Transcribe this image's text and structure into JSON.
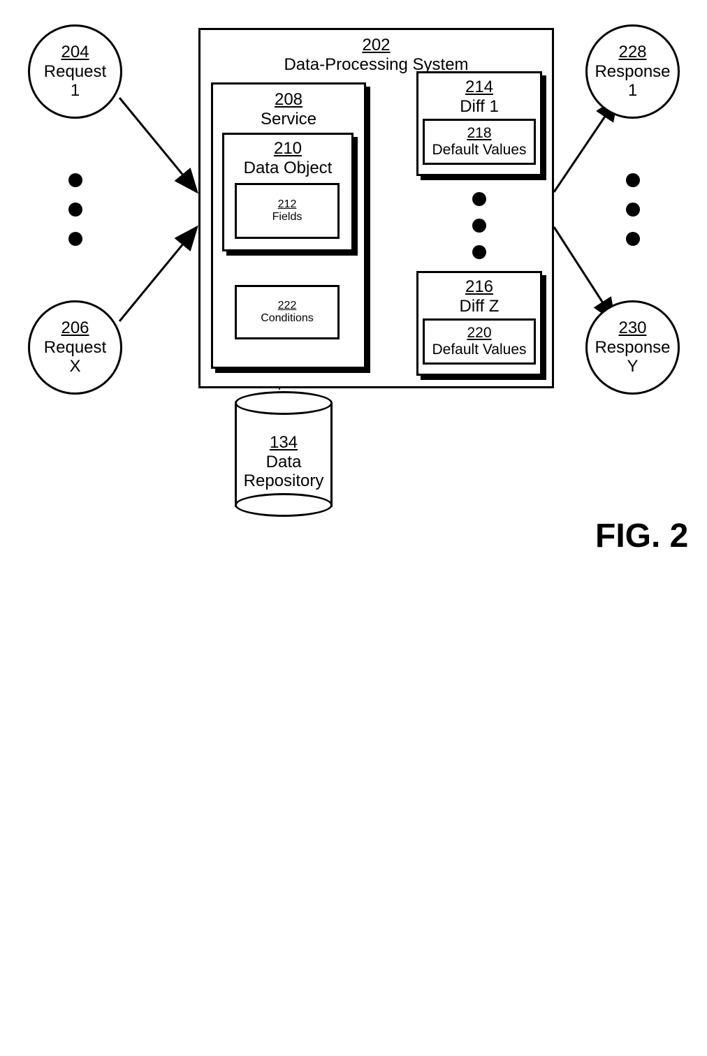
{
  "figure_label": "FIG. 2",
  "system": {
    "num": "202",
    "label": "Data-Processing System"
  },
  "request1": {
    "num": "204",
    "label_line1": "Request",
    "label_line2": "1"
  },
  "requestX": {
    "num": "206",
    "label_line1": "Request",
    "label_line2": "X"
  },
  "service": {
    "num": "208",
    "label": "Service"
  },
  "dataObject": {
    "num": "210",
    "label": "Data Object"
  },
  "fields": {
    "num": "212",
    "label": "Fields"
  },
  "diff1": {
    "num": "214",
    "label": "Diff 1"
  },
  "diffZ": {
    "num": "216",
    "label": "Diff Z"
  },
  "defaults1": {
    "num": "218",
    "label": "Default Values"
  },
  "defaultsZ": {
    "num": "220",
    "label": "Default Values"
  },
  "conditions": {
    "num": "222",
    "label": "Conditions"
  },
  "response1": {
    "num": "228",
    "label_line1": "Response",
    "label_line2": "1"
  },
  "responseY": {
    "num": "230",
    "label_line1": "Response",
    "label_line2": "Y"
  },
  "repo": {
    "num": "134",
    "label_line1": "Data",
    "label_line2": "Repository"
  }
}
